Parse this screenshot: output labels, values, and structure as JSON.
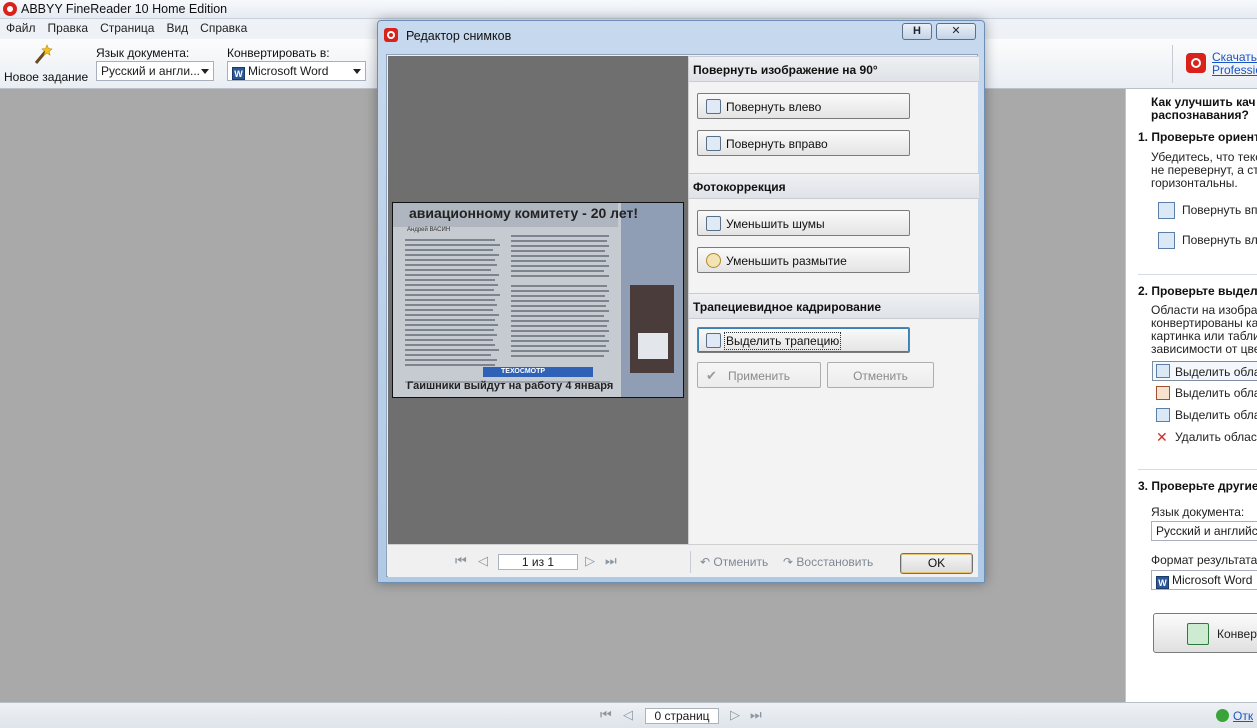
{
  "app": {
    "title": "ABBYY FineReader 10 Home Edition"
  },
  "menu": [
    "Файл",
    "Правка",
    "Страница",
    "Вид",
    "Справка"
  ],
  "toolbar": {
    "new_task": "Новое задание",
    "doc_lang_label": "Язык документа:",
    "doc_lang_value": "Русский и англи...",
    "convert_label": "Конвертировать в:",
    "convert_value": "Microsoft Word",
    "promo_line1": "Скачать А",
    "promo_line2": "Professio"
  },
  "dialog": {
    "title": "Редактор снимков",
    "rotate": {
      "header": "Повернуть изображение на 90°",
      "left": "Повернуть влево",
      "right": "Повернуть вправо"
    },
    "photo": {
      "header": "Фотокоррекция",
      "noise": "Уменьшить шумы",
      "blur": "Уменьшить размытие"
    },
    "trapeze": {
      "header": "Трапециевидное кадрирование",
      "select": "Выделить трапецию",
      "apply": "Применить",
      "cancel": "Отменить"
    },
    "bottom": {
      "page": "1 из 1",
      "undo": "Отменить",
      "redo": "Восстановить",
      "ok": "OK"
    },
    "thumbnail": {
      "headline": "авиационному комитету - 20 лет!",
      "byline": "Андрей ВАСИН",
      "tag": "ТЕХОСМОТР",
      "subhead": "Гаишники выйдут на работу 4 января"
    }
  },
  "task_pane": {
    "title_line1": "Как улучшить кач",
    "title_line2": "распознавания?",
    "step1": {
      "header": "1. Проверьте ориент",
      "text1": "Убедитесь, что текс",
      "text2": "не перевернут, а стр",
      "text3": "горизонтальны.",
      "btn_right": "Повернуть впр",
      "btn_left": "Повернуть вле"
    },
    "step2": {
      "header": "2. Проверьте выдел",
      "text1": "Области на изображ",
      "text2": "конвертированы как",
      "text3": "картинка или табли",
      "text4": "зависимости от цвета",
      "item1": "Выделить облас",
      "item2": "Выделить облас",
      "item3": "Выделить облас",
      "item4": "Удалить област"
    },
    "step3": {
      "header": "3. Проверьте другие",
      "lang_label": "Язык документа:",
      "lang_value": "Русский и английски",
      "format_label": "Формат результата:",
      "format_value": "Microsoft Word",
      "convert_btn": "Конверт"
    }
  },
  "status": {
    "pages": "0 страниц",
    "link": "Отк"
  }
}
